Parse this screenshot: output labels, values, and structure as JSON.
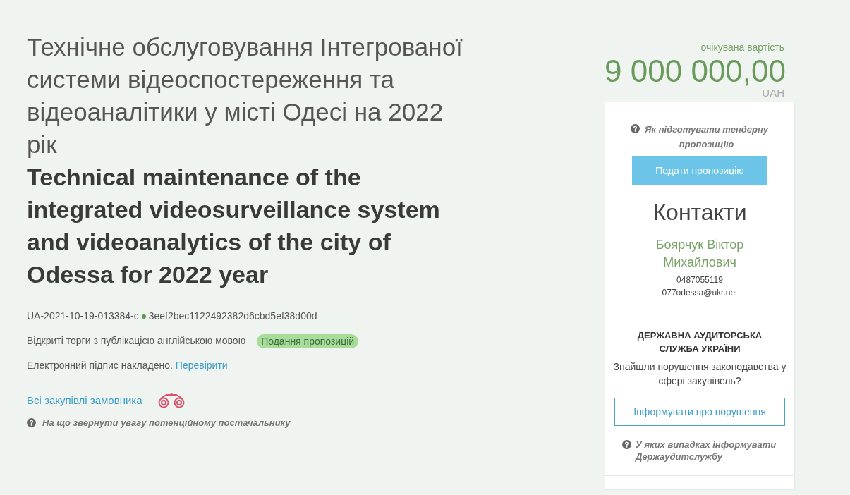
{
  "title_uk": "Технічне обслуговування Інтегрованої системи відеоспостереження та відеоаналітики у місті Одесі на 2022 рік",
  "title_en": "Technical maintenance of the integrated videosurveillance system and videoanalytics of the city of Odessa for 2022 year",
  "tender_id": "UA-2021-10-19-013384-c",
  "hash": "3eef2bec1122492382d6cbd5ef38d00d",
  "procedure": "Відкриті торги з публікацією англійською мовою",
  "status": "Подання пропозицій",
  "signature": {
    "text": "Електронний підпис накладено.",
    "link": "Перевірити"
  },
  "customer_link": "Всі закупівлі замовника",
  "supplier_hint": "На що звернути увагу потенційному постачальнику",
  "price": {
    "label": "очікувана вартість",
    "amount": "9 000 000,00",
    "currency": "UAH"
  },
  "sidebar": {
    "howto": "Як підготувати тендерну пропозицію",
    "submit_button": "Подати пропозицію",
    "contacts_title": "Контакти",
    "contact_name": "Боярчук Віктор Михайлович",
    "phone": "0487055119",
    "email": "077odessa@ukr.net",
    "audit_title": "ДЕРЖАВНА АУДИТОРСЬКА СЛУЖБА УКРАЇНИ",
    "audit_question": "Знайшли порушення законодавства у сфері закупівель?",
    "audit_button": "Інформувати про порушення",
    "audit_hint": "У яких випадках інформувати Держаудитслужбу"
  }
}
